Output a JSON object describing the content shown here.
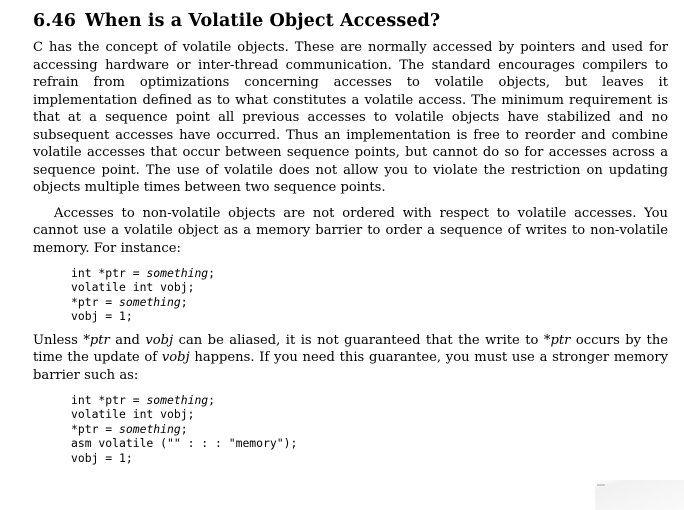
{
  "document": {
    "section": {
      "number": "6.46",
      "title": "When is a Volatile Object Accessed?"
    },
    "paragraphs": {
      "p1": "C has the concept of volatile objects. These are normally accessed by pointers and used for accessing hardware or inter-thread communication. The standard encourages compilers to refrain from optimizations concerning accesses to volatile objects, but leaves it implementation defined as to what constitutes a volatile access. The minimum requirement is that at a sequence point all previous accesses to volatile objects have stabilized and no subsequent accesses have occurred. Thus an implementation is free to reorder and combine volatile accesses that occur between sequence points, but cannot do so for accesses across a sequence point. The use of volatile does not allow you to violate the restriction on updating objects multiple times between two sequence points.",
      "p2": "Accesses to non-volatile objects are not ordered with respect to volatile accesses. You cannot use a volatile object as a memory barrier to order a sequence of writes to non-volatile memory. For instance:",
      "p3_part1": "Unless ",
      "p3_em1": "*ptr",
      "p3_part2": " and ",
      "p3_em2": "vobj",
      "p3_part3": " can be aliased, it is not guaranteed that the write to ",
      "p3_em3": "*ptr",
      "p3_part4": " occurs by the time the update of ",
      "p3_em4": "vobj",
      "p3_part5": " happens. If you need this guarantee, you must use a stronger memory barrier such as:"
    },
    "code_block_1": {
      "line1_pre": "int *ptr = ",
      "line1_em": "something",
      "line1_post": ";",
      "line2": "volatile int vobj;",
      "line3_pre": "*ptr = ",
      "line3_em": "something",
      "line3_post": ";",
      "line4": "vobj = 1;"
    },
    "code_block_2": {
      "line1_pre": "int *ptr = ",
      "line1_em": "something",
      "line1_post": ";",
      "line2": "volatile int vobj;",
      "line3_pre": "*ptr = ",
      "line3_em": "something",
      "line3_post": ";",
      "line4": "asm volatile (\"\" : : : \"memory\");",
      "line5": "vobj = 1;"
    },
    "colors": {
      "page_background": "#ffffff",
      "text": "#000000"
    }
  }
}
